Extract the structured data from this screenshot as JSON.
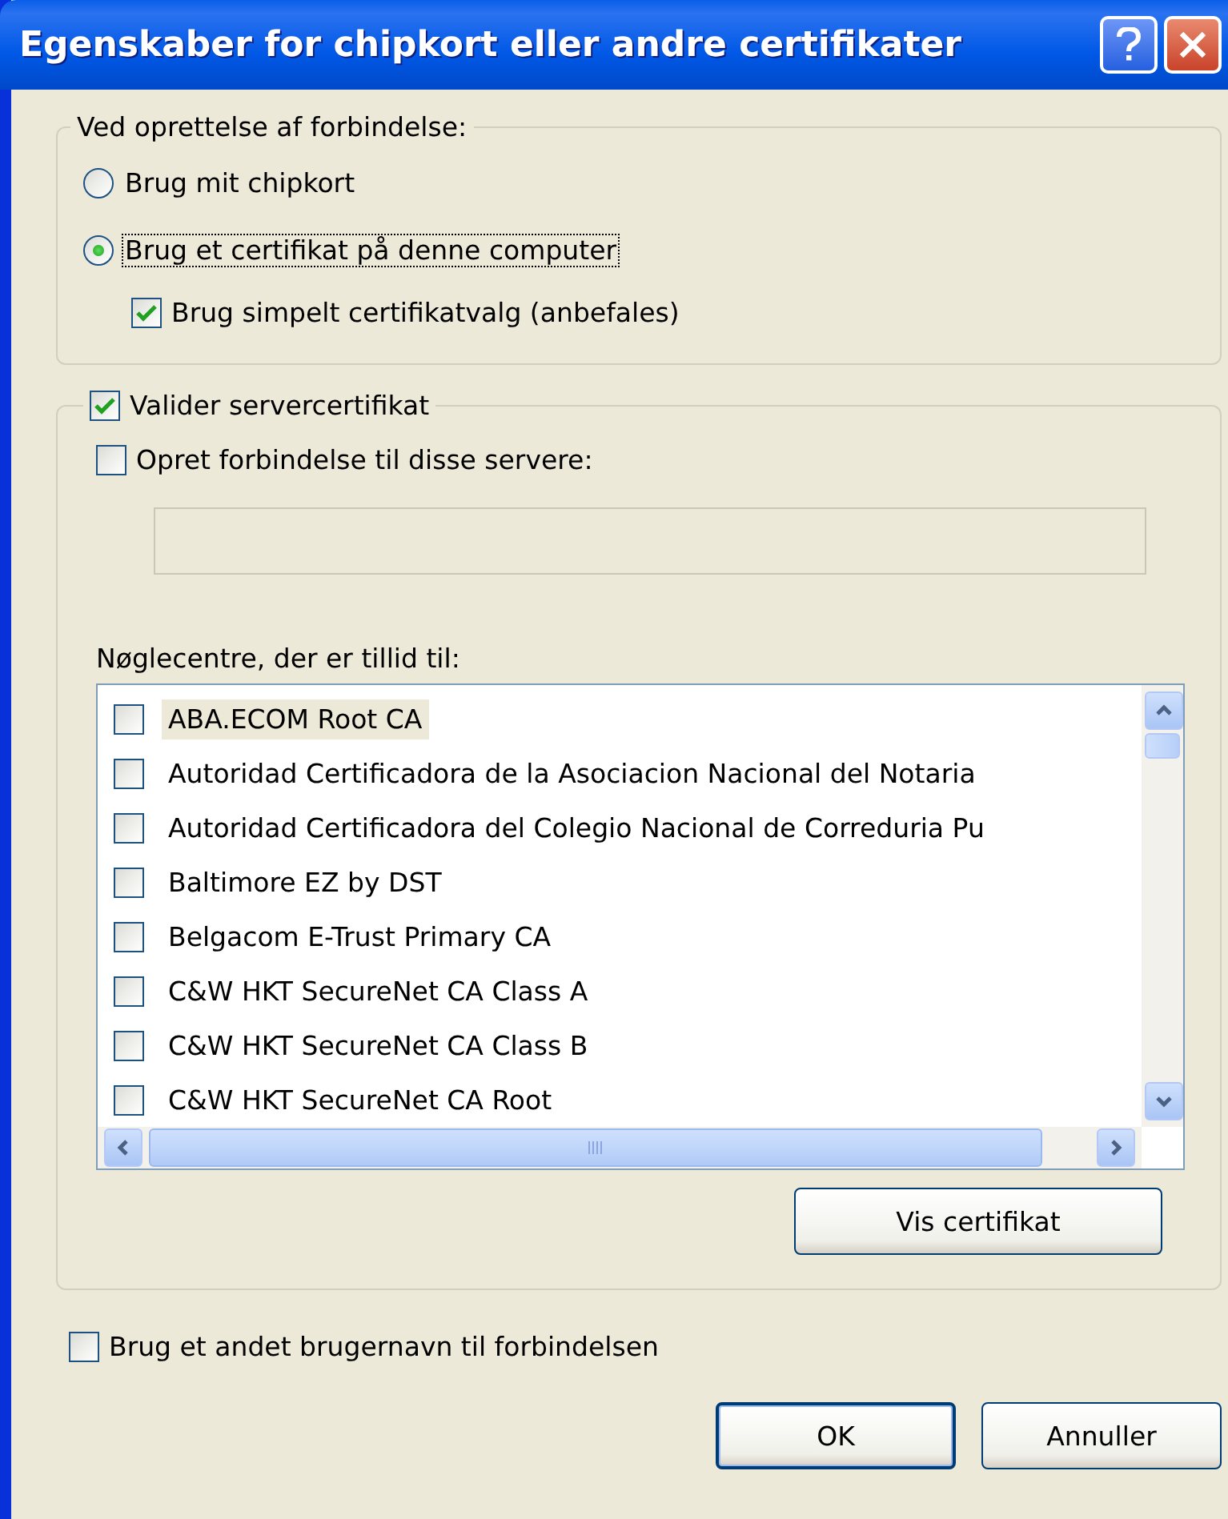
{
  "window": {
    "title": "Egenskaber for chipkort eller andre certifikater"
  },
  "connect_group": {
    "legend": "Ved oprettelse af forbindelse:",
    "options": [
      {
        "label": "Brug mit chipkort",
        "selected": false,
        "focused": false
      },
      {
        "label": "Brug et certifikat på denne computer",
        "selected": true,
        "focused": true
      }
    ],
    "simple_selection": {
      "label": "Brug simpelt certifikatvalg (anbefales)",
      "checked": true
    }
  },
  "server_group": {
    "validate": {
      "label": "Valider servercertifikat",
      "checked": true
    },
    "connect_servers": {
      "label": "Opret forbindelse til disse servere:",
      "checked": false
    },
    "servers_field": {
      "disabled": true
    },
    "ca_label": "Nøglecentre, der er tillid til:",
    "ca_list": [
      {
        "label": "ABA.ECOM Root CA",
        "checked": false,
        "selected": true
      },
      {
        "label": "Autoridad Certificadora de la Asociacion Nacional del Notaria",
        "checked": false,
        "selected": false
      },
      {
        "label": "Autoridad Certificadora del Colegio Nacional de Correduria Pu",
        "checked": false,
        "selected": false
      },
      {
        "label": "Baltimore EZ by DST",
        "checked": false,
        "selected": false
      },
      {
        "label": "Belgacom E-Trust Primary CA",
        "checked": false,
        "selected": false
      },
      {
        "label": "C&W HKT SecureNet CA Class A",
        "checked": false,
        "selected": false
      },
      {
        "label": "C&W HKT SecureNet CA Class B",
        "checked": false,
        "selected": false
      },
      {
        "label": "C&W HKT SecureNet CA Root",
        "checked": false,
        "selected": false
      }
    ],
    "view_button": "Vis certifikat"
  },
  "other_user": {
    "label": "Brug et andet brugernavn til forbindelsen",
    "checked": false
  },
  "buttons": [
    {
      "label": "OK",
      "default": true
    },
    {
      "label": "Annuller",
      "default": false
    }
  ]
}
